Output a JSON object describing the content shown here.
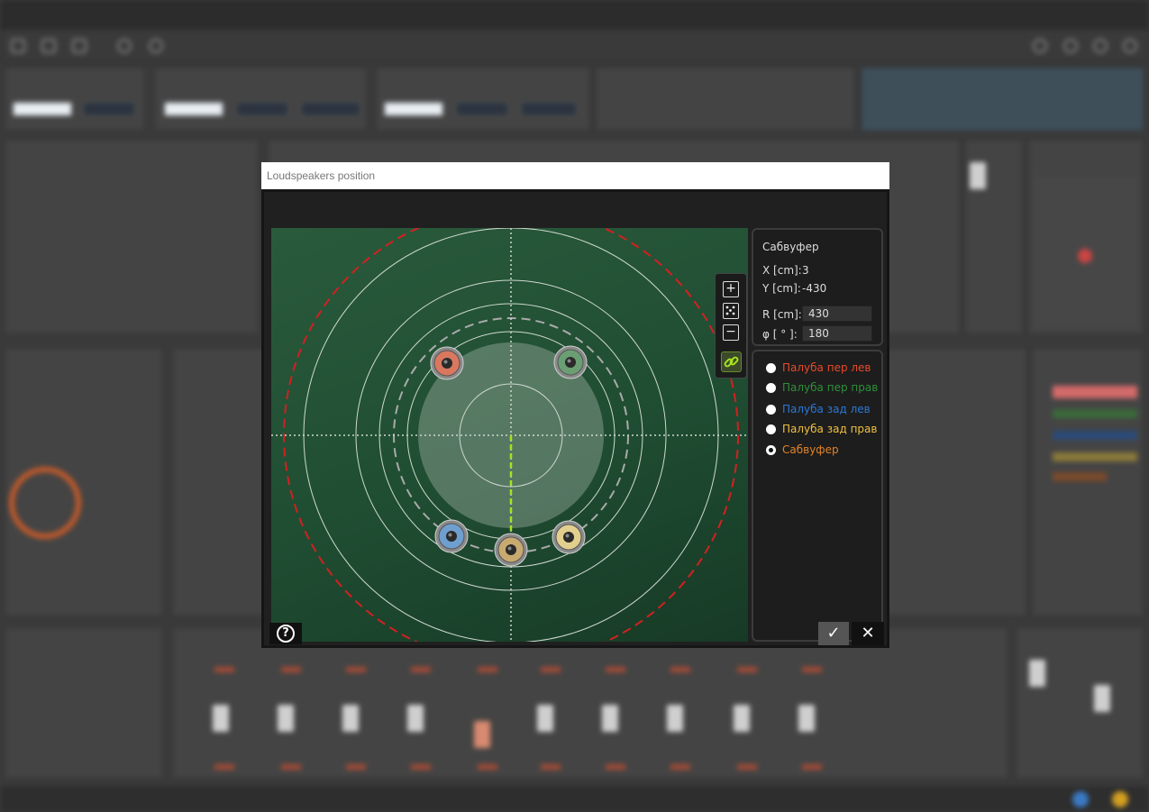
{
  "dialog": {
    "title": "Loudspeakers position"
  },
  "properties": {
    "selected_name": "Сабвуфер",
    "x_label": "X [cm]:",
    "x_value": "3",
    "y_label": "Y [cm]:",
    "y_value": "-430",
    "r_label": "R [cm]:",
    "r_value": "430",
    "phi_label": "φ [ ° ]:",
    "phi_value": "180"
  },
  "speakers": [
    {
      "label": "Палуба пер лев",
      "color": "#e84a2a",
      "cone": "#d9785f",
      "selected": false
    },
    {
      "label": "Палуба пер прав",
      "color": "#2f8f3a",
      "cone": "#6a9e73",
      "selected": false
    },
    {
      "label": "Палуба зад лев",
      "color": "#2a78d6",
      "cone": "#6f9fcf",
      "selected": false
    },
    {
      "label": "Палуба зад прав",
      "color": "#f0c040",
      "cone": "#e2cf8e",
      "selected": false
    },
    {
      "label": "Сабвуфер",
      "color": "#e0842a",
      "cone": "#c8aa70",
      "selected": true
    }
  ],
  "toolbar": {
    "zoom_in_icon": "zoom-in",
    "fit_icon": "fit-view",
    "zoom_out_icon": "zoom-out",
    "link_icon": "link"
  },
  "buttons": {
    "help_icon": "help",
    "ok_icon": "check",
    "cancel_icon": "close"
  }
}
